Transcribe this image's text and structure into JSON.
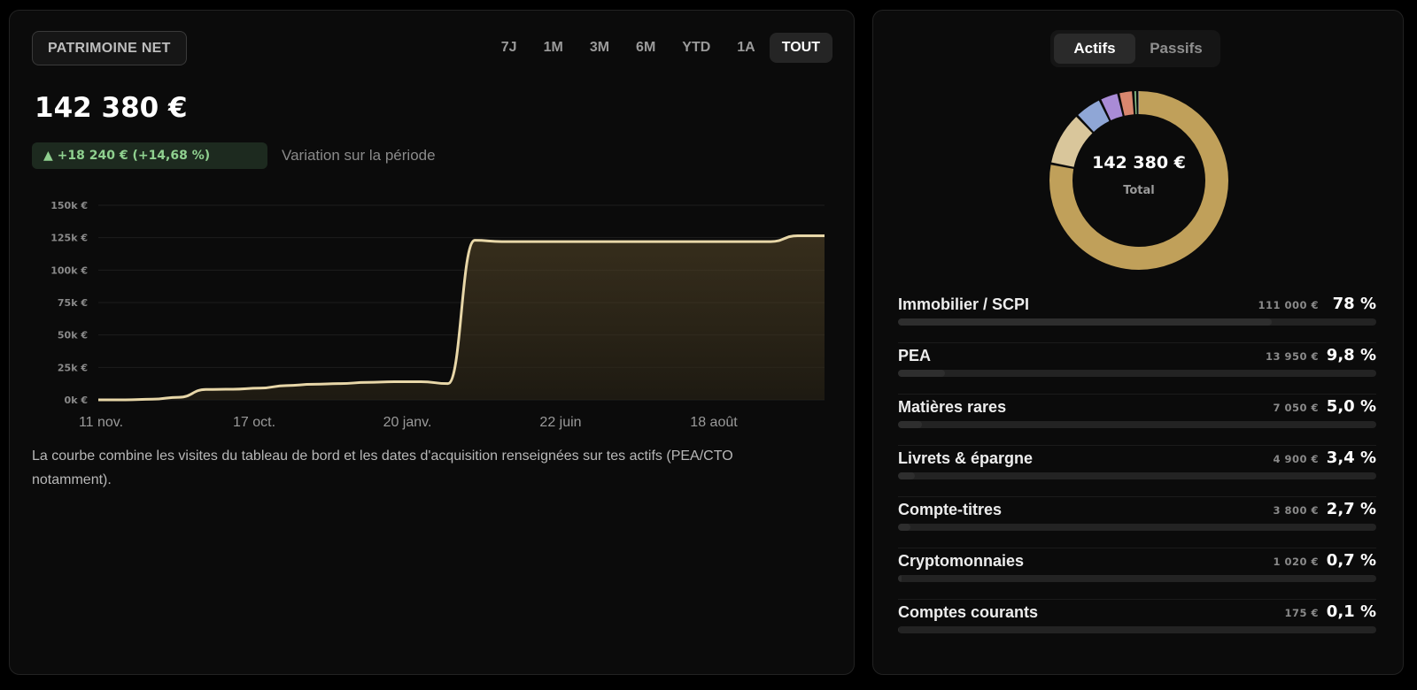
{
  "left": {
    "title": "PATRIMOINE NET",
    "ranges": [
      "7J",
      "1M",
      "3M",
      "6M",
      "YTD",
      "1A",
      "TOUT"
    ],
    "active_range": "TOUT",
    "total": "142 380 €",
    "change": "▲ +18 240 € (+14,68 %)",
    "change_label": "Variation sur la période",
    "note": "La courbe combine les visites du tableau de bord et les dates d'acquisition renseignées sur tes actifs (PEA/CTO notamment)."
  },
  "chart_data": {
    "type": "area",
    "y_ticks": [
      "0k €",
      "25k €",
      "50k €",
      "75k €",
      "100k €",
      "125k €",
      "150k €"
    ],
    "ylim": [
      0,
      150000
    ],
    "x_tick_labels": [
      "11 nov.",
      "17 oct.",
      "20 janv.",
      "22 juin",
      "18 août"
    ],
    "values": [
      0,
      0,
      500,
      2000,
      8000,
      8200,
      9000,
      11000,
      12000,
      12500,
      13500,
      14000,
      14000,
      12500,
      123000,
      122000,
      122000,
      122000,
      122000,
      122000,
      122000,
      122000,
      122000,
      122000,
      122000,
      122000,
      126500,
      126500
    ],
    "line_color": "#e8d7a8",
    "grid": true
  },
  "right": {
    "tabs": [
      "Actifs",
      "Passifs"
    ],
    "active_tab": "Actifs",
    "donut_total": "142 380 €",
    "donut_label": "Total",
    "allocations": [
      {
        "name": "Immobilier / SCPI",
        "amount": "111 000 €",
        "pct": "78 %",
        "value": 111000,
        "color": "#c0a05a"
      },
      {
        "name": "PEA",
        "amount": "13 950 €",
        "pct": "9,8 %",
        "value": 13950,
        "color": "#d9c69b"
      },
      {
        "name": "Matières rares",
        "amount": "7 050 €",
        "pct": "5,0 %",
        "value": 7050,
        "color": "#8fa6d6"
      },
      {
        "name": "Livrets & épargne",
        "amount": "4 900 €",
        "pct": "3,4 %",
        "value": 4900,
        "color": "#a98bd6"
      },
      {
        "name": "Compte-titres",
        "amount": "3 800 €",
        "pct": "2,7 %",
        "value": 3800,
        "color": "#d9876e"
      },
      {
        "name": "Cryptomonnaies",
        "amount": "1 020 €",
        "pct": "0,7 %",
        "value": 1020,
        "color": "#8fc98f"
      },
      {
        "name": "Comptes courants",
        "amount": "175 €",
        "pct": "0,1 %",
        "value": 175,
        "color": "#d9d9d9"
      }
    ]
  }
}
